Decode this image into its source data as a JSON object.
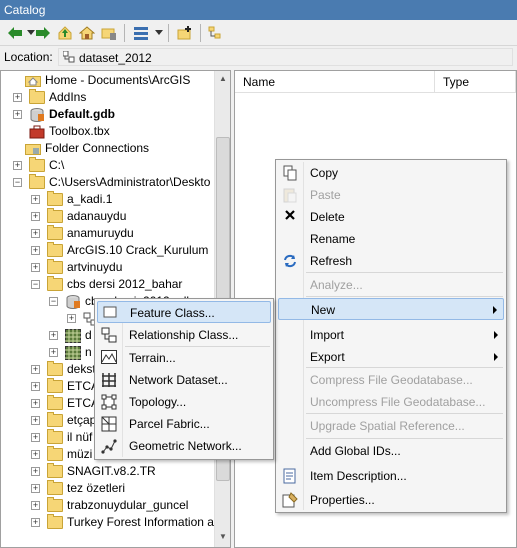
{
  "window": {
    "title": "Catalog"
  },
  "toolbar": {
    "icons": [
      "back-icon",
      "forward-icon",
      "up-icon",
      "home-icon",
      "connect-folder-icon",
      "view-options-icon",
      "dropdown-icon",
      "add-icon",
      "tree-toggle-icon"
    ]
  },
  "location": {
    "label": "Location:",
    "value": "dataset_2012"
  },
  "tree": {
    "items": [
      {
        "label": "Home - Documents\\ArcGIS",
        "icon": "home-folder-icon",
        "expander": "",
        "bold": false
      },
      {
        "label": "AddIns",
        "icon": "folder-icon",
        "expander": "+",
        "bold": false
      },
      {
        "label": "Default.gdb",
        "icon": "geodatabase-icon",
        "expander": "+",
        "bold": true
      },
      {
        "label": "Toolbox.tbx",
        "icon": "toolbox-icon",
        "expander": "",
        "bold": false
      },
      {
        "label": "Folder Connections",
        "icon": "folder-connections-icon",
        "expander": "",
        "bold": false
      },
      {
        "label": "C:\\",
        "icon": "folder-icon",
        "expander": "+",
        "bold": false
      },
      {
        "label": "C:\\Users\\Administrator\\Deskto",
        "icon": "folder-icon",
        "expander": "-",
        "bold": false
      },
      {
        "label": "a_kadi.1",
        "icon": "folder-icon",
        "expander": "+",
        "bold": false
      },
      {
        "label": "adanauydu",
        "icon": "folder-icon",
        "expander": "+",
        "bold": false
      },
      {
        "label": "anamuruydu",
        "icon": "folder-icon",
        "expander": "+",
        "bold": false
      },
      {
        "label": "ArcGIS.10 Crack_Kurulum",
        "icon": "folder-icon",
        "expander": "+",
        "bold": false
      },
      {
        "label": "artvinuydu",
        "icon": "folder-icon",
        "expander": "+",
        "bold": false
      },
      {
        "label": "cbs dersi 2012_bahar",
        "icon": "folder-icon",
        "expander": "-",
        "bold": false
      },
      {
        "label": "cbs_dersi_2012.gdb",
        "icon": "geodatabase-icon",
        "expander": "-",
        "bold": false
      },
      {
        "label": "",
        "icon": "dataset-icon",
        "expander": "+",
        "bold": false
      },
      {
        "label": "d",
        "icon": "raster-icon",
        "expander": "+",
        "bold": false
      },
      {
        "label": "n",
        "icon": "raster-icon",
        "expander": "+",
        "bold": false
      },
      {
        "label": "dekst",
        "icon": "folder-icon",
        "expander": "+",
        "bold": false
      },
      {
        "label": "ETCA",
        "icon": "folder-icon",
        "expander": "+",
        "bold": false
      },
      {
        "label": "ETCA",
        "icon": "folder-icon",
        "expander": "+",
        "bold": false
      },
      {
        "label": "etçap",
        "icon": "folder-icon",
        "expander": "+",
        "bold": false
      },
      {
        "label": "il nüf",
        "icon": "folder-icon",
        "expander": "+",
        "bold": false
      },
      {
        "label": "müzi",
        "icon": "folder-icon",
        "expander": "+",
        "bold": false
      },
      {
        "label": "SNAGIT.v8.2.TR",
        "icon": "folder-icon",
        "expander": "+",
        "bold": false
      },
      {
        "label": "tez özetleri",
        "icon": "folder-icon",
        "expander": "+",
        "bold": false
      },
      {
        "label": "trabzonuydular_guncel",
        "icon": "folder-icon",
        "expander": "+",
        "bold": false
      },
      {
        "label": "Turkey Forest Information a",
        "icon": "folder-icon",
        "expander": "+",
        "bold": false
      }
    ]
  },
  "contents": {
    "columns": [
      "Name",
      "Type"
    ]
  },
  "context_menu": {
    "items": [
      {
        "label": "Copy",
        "icon": "copy-icon",
        "disabled": false,
        "submenu": false
      },
      {
        "label": "Paste",
        "icon": "paste-icon",
        "disabled": true,
        "submenu": false
      },
      {
        "label": "Delete",
        "icon": "delete-icon",
        "disabled": false,
        "submenu": false
      },
      {
        "label": "Rename",
        "icon": "",
        "disabled": false,
        "submenu": false
      },
      {
        "label": "Refresh",
        "icon": "refresh-icon",
        "disabled": false,
        "submenu": false
      },
      {
        "label": "Analyze...",
        "icon": "",
        "disabled": true,
        "submenu": false
      },
      {
        "label": "New",
        "icon": "",
        "disabled": false,
        "submenu": true,
        "highlight": true
      },
      {
        "label": "Import",
        "icon": "",
        "disabled": false,
        "submenu": true
      },
      {
        "label": "Export",
        "icon": "",
        "disabled": false,
        "submenu": true
      },
      {
        "label": "Compress File Geodatabase...",
        "icon": "",
        "disabled": true,
        "submenu": false
      },
      {
        "label": "Uncompress File Geodatabase...",
        "icon": "",
        "disabled": true,
        "submenu": false
      },
      {
        "label": "Upgrade Spatial Reference...",
        "icon": "",
        "disabled": true,
        "submenu": false
      },
      {
        "label": "Add Global IDs...",
        "icon": "",
        "disabled": false,
        "submenu": false
      },
      {
        "label": "Item Description...",
        "icon": "item-description-icon",
        "disabled": false,
        "submenu": false
      },
      {
        "label": "Properties...",
        "icon": "properties-icon",
        "disabled": false,
        "submenu": false
      }
    ]
  },
  "new_submenu": {
    "items": [
      {
        "label": "Feature Class...",
        "icon": "feature-class-icon",
        "highlight": true
      },
      {
        "label": "Relationship Class...",
        "icon": "relationship-class-icon"
      },
      {
        "label": "Terrain...",
        "icon": "terrain-icon"
      },
      {
        "label": "Network Dataset...",
        "icon": "network-dataset-icon"
      },
      {
        "label": "Topology...",
        "icon": "topology-icon"
      },
      {
        "label": "Parcel Fabric...",
        "icon": "parcel-fabric-icon"
      },
      {
        "label": "Geometric Network...",
        "icon": "geometric-network-icon"
      }
    ]
  }
}
